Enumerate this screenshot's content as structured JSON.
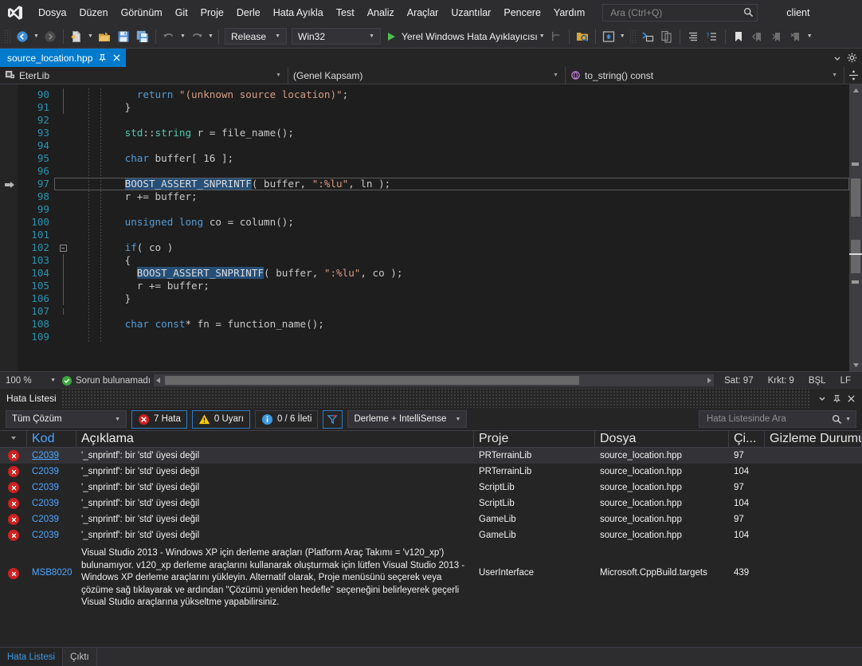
{
  "menubar": {
    "logo_icon": "visual-studio-logo",
    "items": [
      "Dosya",
      "Düzen",
      "Görünüm",
      "Git",
      "Proje",
      "Derle",
      "Hata Ayıkla",
      "Test",
      "Analiz",
      "Araçlar",
      "Uzantılar",
      "Pencere",
      "Yardım"
    ],
    "search": {
      "placeholder": "Ara (Ctrl+Q)",
      "value": "",
      "icon": "search-icon"
    },
    "account": "client"
  },
  "toolbar": {
    "navigate_back_icon": "navigate-back-icon",
    "navigate_forward_icon": "navigate-forward-icon",
    "new_item_icon": "new-item-icon",
    "open_file_icon": "open-file-icon",
    "save_icon": "save-icon",
    "save_all_icon": "save-all-icon",
    "undo_icon": "undo-icon",
    "redo_icon": "redo-icon",
    "configuration": "Release",
    "platform": "Win32",
    "start_debug_label": "Yerel Windows Hata Ayıklayıcısı",
    "play_icon": "play-icon",
    "icons": [
      "step-icon",
      "solution-explorer-icon",
      "preview-icon",
      "properties-window-icon",
      "toolbox-icon",
      "code-format-icon",
      "outline-icon",
      "bookmark-icon",
      "next-bookmark-icon",
      "prev-bookmark-icon",
      "clear-bookmark-icon",
      "overflow-icon"
    ]
  },
  "tabstrip": {
    "tab_label": "source_location.hpp",
    "pin_icon": "pin-icon",
    "close_icon": "close-icon",
    "chevron_icon": "chevron-down-icon",
    "settings_icon": "gear-icon"
  },
  "navbar": {
    "project": "EterLib",
    "project_icon": "project-icon",
    "scope": "(Genel Kapsam)",
    "member": "to_string() const",
    "member_icon": "method-icon",
    "split_icon": "split-view-icon"
  },
  "editor": {
    "breakpoint_marker_icon": "current-statement-arrow-icon",
    "lines": [
      {
        "num": "90",
        "indent": 5,
        "tokens": [
          {
            "t": "k",
            "v": "return"
          },
          {
            "t": "m",
            "v": " "
          },
          {
            "t": "s",
            "v": "\"(unknown source location)\""
          },
          {
            "t": "m",
            "v": ";"
          }
        ]
      },
      {
        "num": "91",
        "indent": 4,
        "tokens": [
          {
            "t": "m",
            "v": "}"
          }
        ]
      },
      {
        "num": "92",
        "indent": 0,
        "tokens": []
      },
      {
        "num": "93",
        "indent": 4,
        "tokens": [
          {
            "t": "t",
            "v": "std"
          },
          {
            "t": "m",
            "v": "::"
          },
          {
            "t": "t",
            "v": "string"
          },
          {
            "t": "m",
            "v": " r = file_name();"
          }
        ]
      },
      {
        "num": "94",
        "indent": 0,
        "tokens": []
      },
      {
        "num": "95",
        "indent": 4,
        "tokens": [
          {
            "t": "k",
            "v": "char"
          },
          {
            "t": "m",
            "v": " buffer[ 16 ];"
          }
        ]
      },
      {
        "num": "96",
        "indent": 0,
        "tokens": []
      },
      {
        "num": "97",
        "indent": 4,
        "tokens": [
          {
            "t": "sel",
            "v": "BOOST_ASSERT_SNPRINTF"
          },
          {
            "t": "m",
            "v": "( buffer, "
          },
          {
            "t": "s",
            "v": "\":%lu\""
          },
          {
            "t": "m",
            "v": ", ln );"
          }
        ]
      },
      {
        "num": "98",
        "indent": 4,
        "tokens": [
          {
            "t": "m",
            "v": "r += buffer;"
          }
        ]
      },
      {
        "num": "99",
        "indent": 0,
        "tokens": []
      },
      {
        "num": "100",
        "indent": 4,
        "tokens": [
          {
            "t": "k",
            "v": "unsigned"
          },
          {
            "t": "m",
            "v": " "
          },
          {
            "t": "k",
            "v": "long"
          },
          {
            "t": "m",
            "v": " co = column();"
          }
        ]
      },
      {
        "num": "101",
        "indent": 0,
        "tokens": []
      },
      {
        "num": "102",
        "indent": 4,
        "tokens": [
          {
            "t": "k",
            "v": "if"
          },
          {
            "t": "m",
            "v": "( co )"
          }
        ]
      },
      {
        "num": "103",
        "indent": 4,
        "tokens": [
          {
            "t": "m",
            "v": "{"
          }
        ]
      },
      {
        "num": "104",
        "indent": 5,
        "tokens": [
          {
            "t": "sel",
            "v": "BOOST_ASSERT_SNPRINTF"
          },
          {
            "t": "m",
            "v": "( buffer, "
          },
          {
            "t": "s",
            "v": "\":%lu\""
          },
          {
            "t": "m",
            "v": ", co );"
          }
        ]
      },
      {
        "num": "105",
        "indent": 5,
        "tokens": [
          {
            "t": "m",
            "v": "r += buffer;"
          }
        ]
      },
      {
        "num": "106",
        "indent": 4,
        "tokens": [
          {
            "t": "m",
            "v": "}"
          }
        ]
      },
      {
        "num": "107",
        "indent": 0,
        "tokens": []
      },
      {
        "num": "108",
        "indent": 4,
        "tokens": [
          {
            "t": "k",
            "v": "char"
          },
          {
            "t": "m",
            "v": " "
          },
          {
            "t": "k",
            "v": "const"
          },
          {
            "t": "m",
            "v": "* fn = function_name();"
          }
        ]
      },
      {
        "num": "109",
        "indent": 0,
        "tokens": []
      }
    ]
  },
  "editor_status": {
    "zoom": "100 %",
    "issues": "Sorun bulunamadı",
    "issues_icon": "check-circle-icon",
    "line": "Sat: 97",
    "column": "Krkt: 9",
    "insert_mode": "BŞL",
    "line_endings": "LF"
  },
  "error_panel": {
    "title": "Hata Listesi",
    "menu_icon": "chevron-down-icon",
    "pin_icon": "pin-icon",
    "close_icon": "close-icon",
    "scope_filter": "Tüm Çözüm",
    "errors_label": "7 Hata",
    "warnings_label": "0 Uyarı",
    "messages_label": "0 / 6 İleti",
    "error_icon": "error-circle-icon",
    "warning_icon": "warning-triangle-icon",
    "info_icon": "info-circle-icon",
    "filter_icon": "filter-icon",
    "build_filter": "Derleme + IntelliSense",
    "search": {
      "placeholder": "Hata Listesinde Ara",
      "value": "",
      "icon": "search-icon",
      "dropdown_icon": "chevron-down-icon"
    },
    "columns": [
      "Kod",
      "Açıklama",
      "Proje",
      "Dosya",
      "Çi...",
      "Gizleme Durumu"
    ],
    "rows": [
      {
        "severity": "error",
        "code": "C2039",
        "description": "'_snprintf': bir 'std' üyesi değil",
        "project": "PRTerrainLib",
        "file": "source_location.hpp",
        "line": "97",
        "suppression": "",
        "selected": true
      },
      {
        "severity": "error",
        "code": "C2039",
        "description": "'_snprintf': bir 'std' üyesi değil",
        "project": "PRTerrainLib",
        "file": "source_location.hpp",
        "line": "104",
        "suppression": "",
        "selected": false
      },
      {
        "severity": "error",
        "code": "C2039",
        "description": "'_snprintf': bir 'std' üyesi değil",
        "project": "ScriptLib",
        "file": "source_location.hpp",
        "line": "97",
        "suppression": "",
        "selected": false
      },
      {
        "severity": "error",
        "code": "C2039",
        "description": "'_snprintf': bir 'std' üyesi değil",
        "project": "ScriptLib",
        "file": "source_location.hpp",
        "line": "104",
        "suppression": "",
        "selected": false
      },
      {
        "severity": "error",
        "code": "C2039",
        "description": "'_snprintf': bir 'std' üyesi değil",
        "project": "GameLib",
        "file": "source_location.hpp",
        "line": "97",
        "suppression": "",
        "selected": false
      },
      {
        "severity": "error",
        "code": "C2039",
        "description": "'_snprintf': bir 'std' üyesi değil",
        "project": "GameLib",
        "file": "source_location.hpp",
        "line": "104",
        "suppression": "",
        "selected": false
      },
      {
        "severity": "error",
        "code": "MSB8020",
        "description": "Visual Studio 2013 - Windows XP için derleme araçları (Platform Araç Takımı = 'v120_xp') bulunamıyor. v120_xp derleme araçlarını kullanarak oluşturmak için lütfen Visual Studio 2013 - Windows XP derleme araçlarını yükleyin. Alternatif olarak, Proje menüsünü seçerek veya çözüme sağ tıklayarak ve ardından \"Çözümü yeniden hedefle\" seçeneğini belirleyerek geçerli Visual Studio araçlarına yükseltme yapabilirsiniz.",
        "project": "UserInterface",
        "file": "Microsoft.CppBuild.targets",
        "line": "439",
        "suppression": "",
        "selected": false,
        "tall": true
      }
    ]
  },
  "bottom_tabs": [
    {
      "label": "Hata Listesi",
      "active": true
    },
    {
      "label": "Çıktı",
      "active": false
    }
  ],
  "colors": {
    "accent": "#007acc",
    "window_bg": "#2d2d30",
    "editor_bg": "#1e1e1e",
    "panel_bg": "#252526",
    "error_red": "#cf2020",
    "link_blue": "#4da6ff",
    "keyword_blue": "#569cd6",
    "string_orange": "#d69d85",
    "type_teal": "#4ec9b0",
    "selection_blue": "#264f78",
    "linenum_blue": "#2b91af",
    "success_green": "#3fa63f",
    "warning_yellow": "#ffcc00"
  }
}
